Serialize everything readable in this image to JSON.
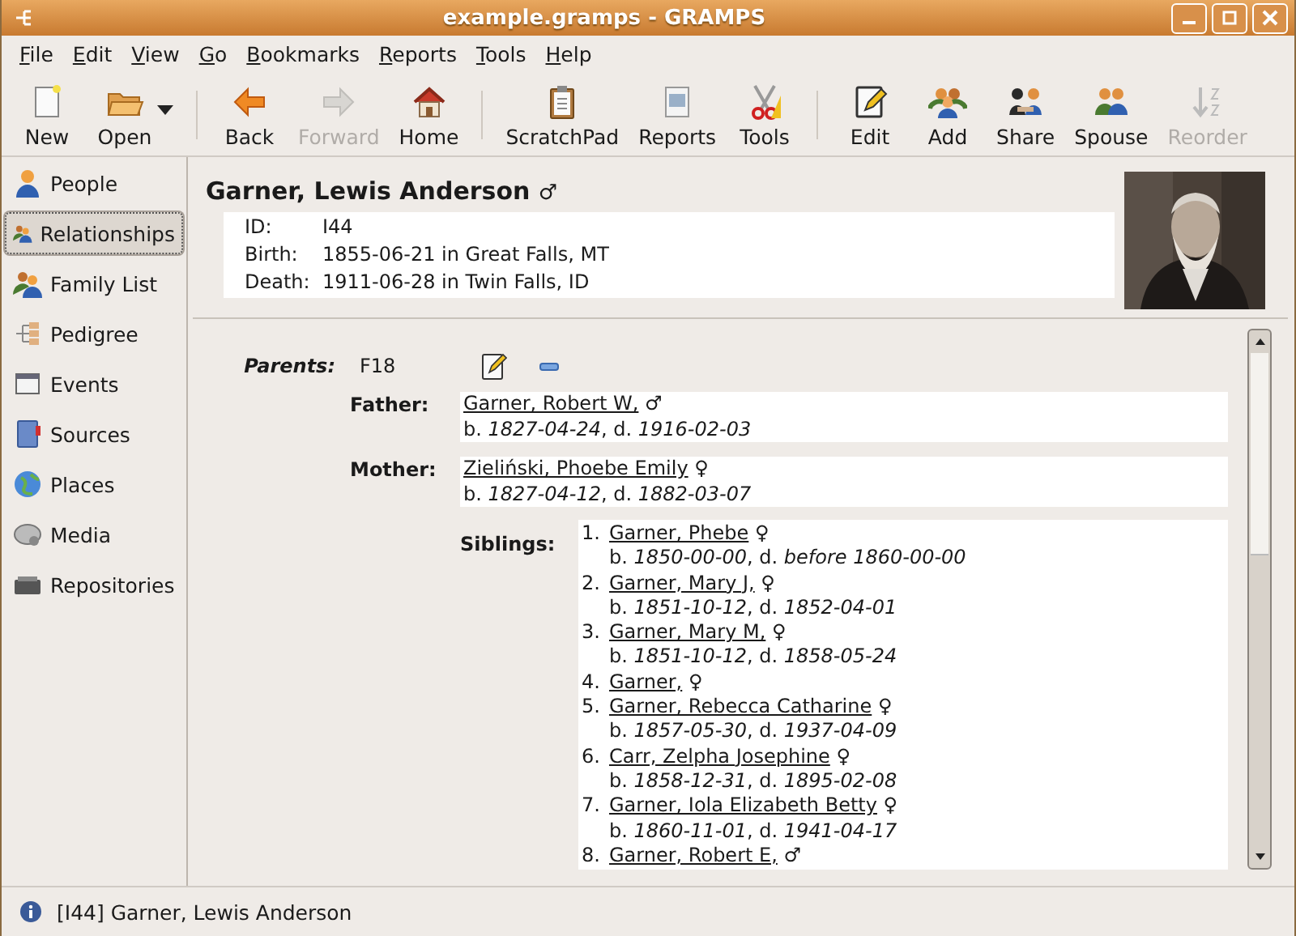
{
  "window": {
    "title": "example.gramps - GRAMPS"
  },
  "menu": [
    "File",
    "Edit",
    "View",
    "Go",
    "Bookmarks",
    "Reports",
    "Tools",
    "Help"
  ],
  "toolbar": [
    [
      {
        "label": "New",
        "disabled": false
      },
      {
        "label": "Open",
        "disabled": false,
        "dropdown": true
      }
    ],
    [
      {
        "label": "Back",
        "disabled": false
      },
      {
        "label": "Forward",
        "disabled": true
      },
      {
        "label": "Home",
        "disabled": false
      }
    ],
    [
      {
        "label": "ScratchPad",
        "disabled": false
      },
      {
        "label": "Reports",
        "disabled": false
      },
      {
        "label": "Tools",
        "disabled": false
      }
    ],
    [
      {
        "label": "Edit",
        "disabled": false
      },
      {
        "label": "Add",
        "disabled": false
      },
      {
        "label": "Share",
        "disabled": false
      },
      {
        "label": "Spouse",
        "disabled": false
      },
      {
        "label": "Reorder",
        "disabled": true
      }
    ]
  ],
  "sidebar": {
    "items": [
      {
        "label": "People",
        "selected": false
      },
      {
        "label": "Relationships",
        "selected": true
      },
      {
        "label": "Family List",
        "selected": false
      },
      {
        "label": "Pedigree",
        "selected": false
      },
      {
        "label": "Events",
        "selected": false
      },
      {
        "label": "Sources",
        "selected": false
      },
      {
        "label": "Places",
        "selected": false
      },
      {
        "label": "Media",
        "selected": false
      },
      {
        "label": "Repositories",
        "selected": false
      }
    ]
  },
  "person": {
    "name": "Garner, Lewis Anderson",
    "gender": "♂",
    "facts": [
      {
        "label": "ID:",
        "value": "I44"
      },
      {
        "label": "Birth:",
        "value": "1855-06-21 in Great Falls, MT"
      },
      {
        "label": "Death:",
        "value": "1911-06-28 in Twin Falls, ID"
      }
    ]
  },
  "family": {
    "parents_label": "Parents:",
    "family_id": "F18",
    "parents": [
      {
        "role": "Father:",
        "name": "Garner, Robert W,",
        "gender": "♂",
        "dates": "b. *1827-04-24*, d. *1916-02-03*"
      },
      {
        "role": "Mother:",
        "name": "Zieliński, Phoebe Emily",
        "gender": "♀",
        "dates": "b. *1827-04-12*, d. *1882-03-07*"
      }
    ],
    "siblings_label": "Siblings:",
    "siblings": [
      {
        "number": "1.",
        "name": "Garner, Phebe",
        "gender": "♀",
        "dates": "b. *1850-00-00*, d. *before 1860-00-00*"
      },
      {
        "number": "2.",
        "name": "Garner, Mary J,",
        "gender": "♀",
        "dates": "b. *1851-10-12*, d. *1852-04-01*"
      },
      {
        "number": "3.",
        "name": "Garner, Mary M,",
        "gender": "♀",
        "dates": "b. *1851-10-12*, d. *1858-05-24*"
      },
      {
        "number": "4.",
        "name": "Garner,",
        "gender": "♀"
      },
      {
        "number": "5.",
        "name": "Garner, Rebecca Catharine",
        "gender": "♀",
        "dates": "b. *1857-05-30*, d. *1937-04-09*"
      },
      {
        "number": "6.",
        "name": "Carr, Zelpha Josephine",
        "gender": "♀",
        "dates": "b. *1858-12-31*, d. *1895-02-08*"
      },
      {
        "number": "7.",
        "name": "Garner, Iola Elizabeth Betty",
        "gender": "♀",
        "dates": "b. *1860-11-01*, d. *1941-04-17*"
      },
      {
        "number": "8.",
        "name": "Garner, Robert E,",
        "gender": "♂"
      }
    ]
  },
  "status_bar": {
    "text": "[I44] Garner, Lewis Anderson"
  }
}
